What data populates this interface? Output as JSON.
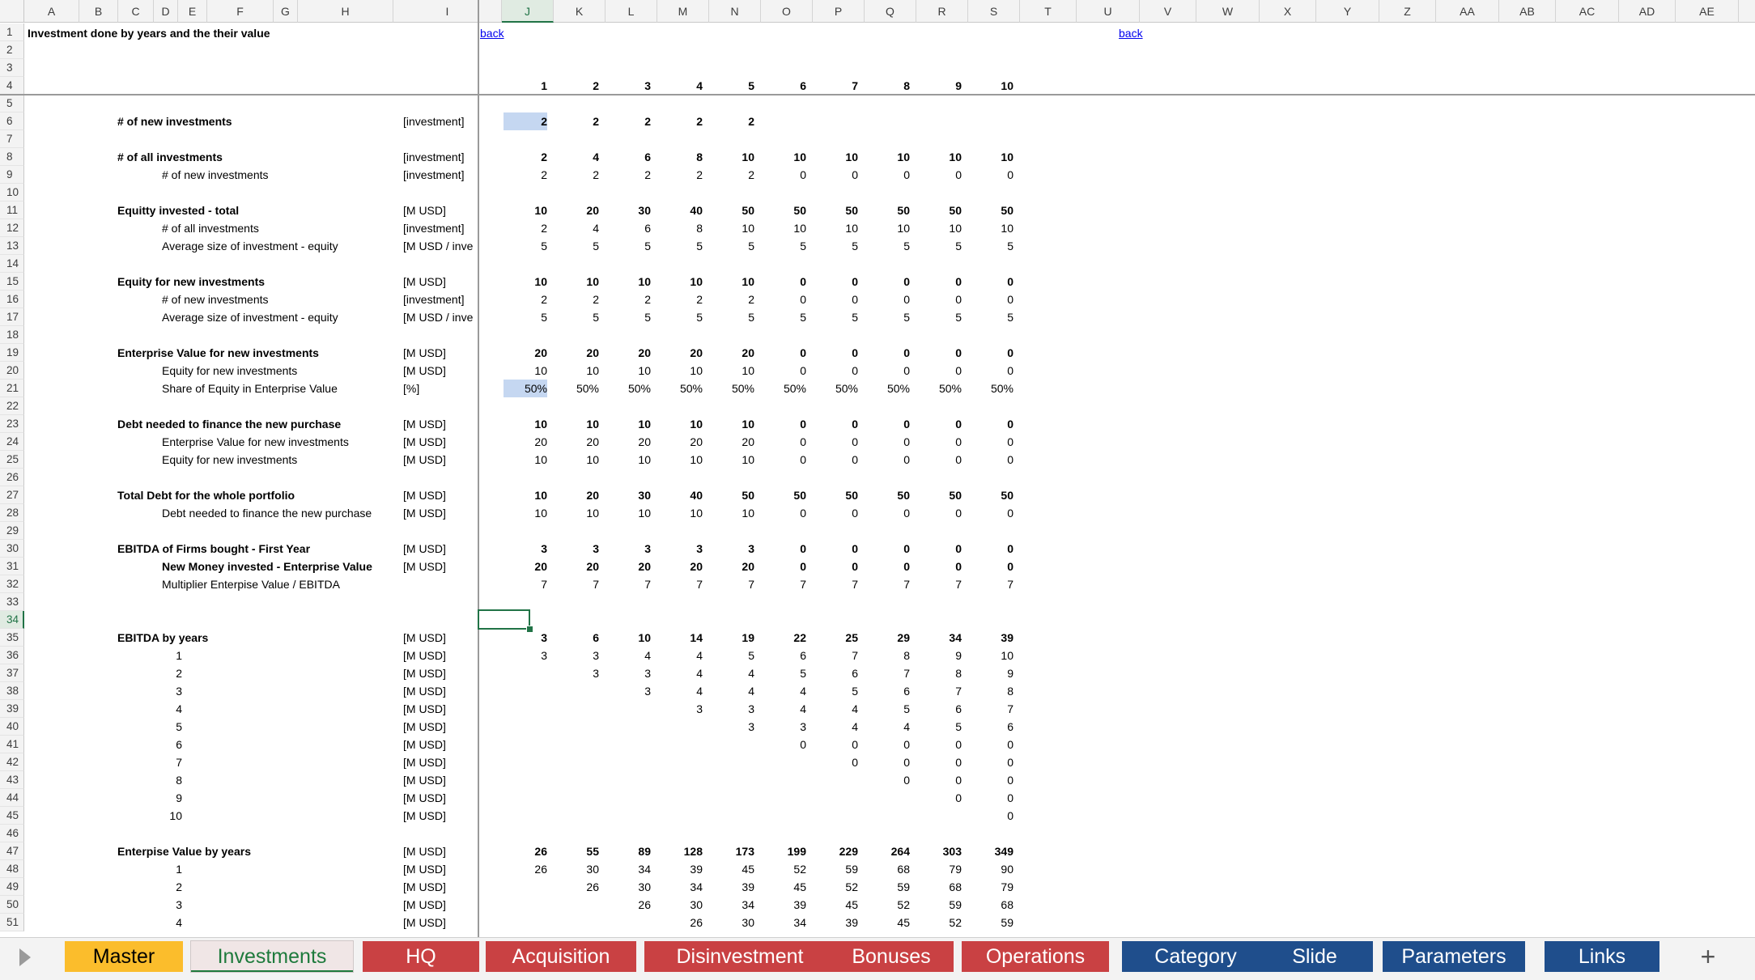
{
  "columns": [
    "A",
    "B",
    "C",
    "D",
    "E",
    "F",
    "G",
    "H",
    "I",
    "J",
    "K",
    "L",
    "M",
    "N",
    "O",
    "P",
    "Q",
    "R",
    "S",
    "T",
    "U",
    "V",
    "W",
    "X",
    "Y",
    "Z",
    "AA",
    "AB",
    "AC",
    "AD",
    "AE",
    "AF"
  ],
  "selected_column": "J",
  "selected_row": "34",
  "row_numbers": [
    "1",
    "2",
    "3",
    "4",
    "5",
    "6",
    "7",
    "8",
    "9",
    "10",
    "11",
    "12",
    "13",
    "14",
    "15",
    "16",
    "17",
    "18",
    "19",
    "20",
    "21",
    "22",
    "23",
    "24",
    "25",
    "26",
    "27",
    "28",
    "29",
    "30",
    "31",
    "32",
    "33",
    "34",
    "35",
    "36",
    "37",
    "38",
    "39",
    "40",
    "41",
    "42",
    "43",
    "44",
    "45",
    "46",
    "47",
    "48",
    "49",
    "50",
    "51"
  ],
  "title": "Investment done by years and the their value",
  "back_link_1": "back",
  "back_link_2": "back",
  "year_headers": [
    "1",
    "2",
    "3",
    "4",
    "5",
    "6",
    "7",
    "8",
    "9",
    "10"
  ],
  "rows": [
    {
      "row": "6",
      "label": "# of new investments",
      "indent": 1,
      "bold": true,
      "unit": "[investment]",
      "values": [
        "2",
        "2",
        "2",
        "2",
        "2",
        "",
        "",
        "",
        "",
        ""
      ]
    },
    {
      "row": "8",
      "label": "# of all investments",
      "indent": 1,
      "bold": true,
      "unit": "[investment]",
      "values": [
        "2",
        "4",
        "6",
        "8",
        "10",
        "10",
        "10",
        "10",
        "10",
        "10"
      ]
    },
    {
      "row": "9",
      "label": "# of new investments",
      "indent": 2,
      "bold": false,
      "unit": "[investment]",
      "values": [
        "2",
        "2",
        "2",
        "2",
        "2",
        "0",
        "0",
        "0",
        "0",
        "0"
      ]
    },
    {
      "row": "11",
      "label": "Equitty invested - total",
      "indent": 1,
      "bold": true,
      "unit": "[M USD]",
      "values": [
        "10",
        "20",
        "30",
        "40",
        "50",
        "50",
        "50",
        "50",
        "50",
        "50"
      ]
    },
    {
      "row": "12",
      "label": "# of all investments",
      "indent": 2,
      "bold": false,
      "unit": "[investment]",
      "values": [
        "2",
        "4",
        "6",
        "8",
        "10",
        "10",
        "10",
        "10",
        "10",
        "10"
      ]
    },
    {
      "row": "13",
      "label": "Average size of investment - equity",
      "indent": 2,
      "bold": false,
      "unit": "[M USD / inve",
      "values": [
        "5",
        "5",
        "5",
        "5",
        "5",
        "5",
        "5",
        "5",
        "5",
        "5"
      ]
    },
    {
      "row": "15",
      "label": "Equity for new investments",
      "indent": 1,
      "bold": true,
      "unit": "[M USD]",
      "values": [
        "10",
        "10",
        "10",
        "10",
        "10",
        "0",
        "0",
        "0",
        "0",
        "0"
      ]
    },
    {
      "row": "16",
      "label": "# of new investments",
      "indent": 2,
      "bold": false,
      "unit": "[investment]",
      "values": [
        "2",
        "2",
        "2",
        "2",
        "2",
        "0",
        "0",
        "0",
        "0",
        "0"
      ]
    },
    {
      "row": "17",
      "label": "Average size of investment - equity",
      "indent": 2,
      "bold": false,
      "unit": "[M USD / inve",
      "values": [
        "5",
        "5",
        "5",
        "5",
        "5",
        "5",
        "5",
        "5",
        "5",
        "5"
      ]
    },
    {
      "row": "19",
      "label": "Enterprise Value for new investments",
      "indent": 1,
      "bold": true,
      "unit": "[M USD]",
      "values": [
        "20",
        "20",
        "20",
        "20",
        "20",
        "0",
        "0",
        "0",
        "0",
        "0"
      ]
    },
    {
      "row": "20",
      "label": "Equity for new investments",
      "indent": 2,
      "bold": false,
      "unit": "[M USD]",
      "values": [
        "10",
        "10",
        "10",
        "10",
        "10",
        "0",
        "0",
        "0",
        "0",
        "0"
      ]
    },
    {
      "row": "21",
      "label": "Share of Equity in Enterprise Value",
      "indent": 2,
      "bold": false,
      "unit": "[%]",
      "values": [
        "50%",
        "50%",
        "50%",
        "50%",
        "50%",
        "50%",
        "50%",
        "50%",
        "50%",
        "50%"
      ]
    },
    {
      "row": "23",
      "label": "Debt needed to finance the new purchase",
      "indent": 1,
      "bold": true,
      "unit": "[M USD]",
      "values": [
        "10",
        "10",
        "10",
        "10",
        "10",
        "0",
        "0",
        "0",
        "0",
        "0"
      ]
    },
    {
      "row": "24",
      "label": "Enterprise Value for new investments",
      "indent": 2,
      "bold": false,
      "unit": "[M USD]",
      "values": [
        "20",
        "20",
        "20",
        "20",
        "20",
        "0",
        "0",
        "0",
        "0",
        "0"
      ]
    },
    {
      "row": "25",
      "label": "Equity for new investments",
      "indent": 2,
      "bold": false,
      "unit": "[M USD]",
      "values": [
        "10",
        "10",
        "10",
        "10",
        "10",
        "0",
        "0",
        "0",
        "0",
        "0"
      ]
    },
    {
      "row": "27",
      "label": "Total Debt for the whole portfolio",
      "indent": 1,
      "bold": true,
      "unit": "[M USD]",
      "values": [
        "10",
        "20",
        "30",
        "40",
        "50",
        "50",
        "50",
        "50",
        "50",
        "50"
      ]
    },
    {
      "row": "28",
      "label": "Debt needed to finance the new purchase",
      "indent": 2,
      "bold": false,
      "unit": "[M USD]",
      "values": [
        "10",
        "10",
        "10",
        "10",
        "10",
        "0",
        "0",
        "0",
        "0",
        "0"
      ]
    },
    {
      "row": "30",
      "label": "EBITDA of Firms bought - First Year",
      "indent": 1,
      "bold": true,
      "unit": "[M USD]",
      "values": [
        "3",
        "3",
        "3",
        "3",
        "3",
        "0",
        "0",
        "0",
        "0",
        "0"
      ]
    },
    {
      "row": "31",
      "label": "New Money invested - Enterprise Value",
      "indent": 2,
      "bold": true,
      "unit": "[M USD]",
      "values": [
        "20",
        "20",
        "20",
        "20",
        "20",
        "0",
        "0",
        "0",
        "0",
        "0"
      ]
    },
    {
      "row": "32",
      "label": "Multiplier Enterpise Value / EBITDA",
      "indent": 2,
      "bold": false,
      "unit": "",
      "values": [
        "7",
        "7",
        "7",
        "7",
        "7",
        "7",
        "7",
        "7",
        "7",
        "7"
      ]
    },
    {
      "row": "35",
      "label": "EBITDA by years",
      "indent": 1,
      "bold": true,
      "unit": "[M USD]",
      "values": [
        "3",
        "6",
        "10",
        "14",
        "19",
        "22",
        "25",
        "29",
        "34",
        "39"
      ]
    },
    {
      "row": "36",
      "label": "1",
      "indent": 3,
      "bold": false,
      "unit": "[M USD]",
      "values": [
        "3",
        "3",
        "4",
        "4",
        "5",
        "6",
        "7",
        "8",
        "9",
        "10"
      ]
    },
    {
      "row": "37",
      "label": "2",
      "indent": 3,
      "bold": false,
      "unit": "[M USD]",
      "values": [
        "",
        "3",
        "3",
        "4",
        "4",
        "5",
        "6",
        "7",
        "8",
        "9"
      ]
    },
    {
      "row": "38",
      "label": "3",
      "indent": 3,
      "bold": false,
      "unit": "[M USD]",
      "values": [
        "",
        "",
        "3",
        "4",
        "4",
        "4",
        "5",
        "6",
        "7",
        "8"
      ]
    },
    {
      "row": "39",
      "label": "4",
      "indent": 3,
      "bold": false,
      "unit": "[M USD]",
      "values": [
        "",
        "",
        "",
        "3",
        "3",
        "4",
        "4",
        "5",
        "6",
        "7"
      ]
    },
    {
      "row": "40",
      "label": "5",
      "indent": 3,
      "bold": false,
      "unit": "[M USD]",
      "values": [
        "",
        "",
        "",
        "",
        "3",
        "3",
        "4",
        "4",
        "5",
        "6"
      ]
    },
    {
      "row": "41",
      "label": "6",
      "indent": 3,
      "bold": false,
      "unit": "[M USD]",
      "values": [
        "",
        "",
        "",
        "",
        "",
        "0",
        "0",
        "0",
        "0",
        "0"
      ]
    },
    {
      "row": "42",
      "label": "7",
      "indent": 3,
      "bold": false,
      "unit": "[M USD]",
      "values": [
        "",
        "",
        "",
        "",
        "",
        "",
        "0",
        "0",
        "0",
        "0"
      ]
    },
    {
      "row": "43",
      "label": "8",
      "indent": 3,
      "bold": false,
      "unit": "[M USD]",
      "values": [
        "",
        "",
        "",
        "",
        "",
        "",
        "",
        "0",
        "0",
        "0"
      ]
    },
    {
      "row": "44",
      "label": "9",
      "indent": 3,
      "bold": false,
      "unit": "[M USD]",
      "values": [
        "",
        "",
        "",
        "",
        "",
        "",
        "",
        "",
        "0",
        "0"
      ]
    },
    {
      "row": "45",
      "label": "10",
      "indent": 3,
      "bold": false,
      "unit": "[M USD]",
      "values": [
        "",
        "",
        "",
        "",
        "",
        "",
        "",
        "",
        "",
        "0"
      ]
    },
    {
      "row": "47",
      "label": "Enterpise Value by years",
      "indent": 1,
      "bold": true,
      "unit": "[M USD]",
      "values": [
        "26",
        "55",
        "89",
        "128",
        "173",
        "199",
        "229",
        "264",
        "303",
        "349"
      ]
    },
    {
      "row": "48",
      "label": "1",
      "indent": 3,
      "bold": false,
      "unit": "[M USD]",
      "values": [
        "26",
        "30",
        "34",
        "39",
        "45",
        "52",
        "59",
        "68",
        "79",
        "90"
      ]
    },
    {
      "row": "49",
      "label": "2",
      "indent": 3,
      "bold": false,
      "unit": "[M USD]",
      "values": [
        "",
        "26",
        "30",
        "34",
        "39",
        "45",
        "52",
        "59",
        "68",
        "79"
      ]
    },
    {
      "row": "50",
      "label": "3",
      "indent": 3,
      "bold": false,
      "unit": "[M USD]",
      "values": [
        "",
        "",
        "26",
        "30",
        "34",
        "39",
        "45",
        "52",
        "59",
        "68"
      ]
    },
    {
      "row": "51",
      "label": "4",
      "indent": 3,
      "bold": false,
      "unit": "[M USD]",
      "values": [
        "",
        "",
        "",
        "26",
        "30",
        "34",
        "39",
        "45",
        "52",
        "59"
      ]
    }
  ],
  "highlighted_cells": [
    "J6",
    "J21"
  ],
  "tabs": [
    {
      "label": "Master",
      "bg": "#fbbd2c",
      "fg": "#000000",
      "active": false
    },
    {
      "label": "Investments",
      "bg": "#f0e6e6",
      "fg": "#1e7a3c",
      "active": true
    },
    {
      "label": "HQ",
      "bg": "#c94143",
      "fg": "#ffffff",
      "active": false
    },
    {
      "label": "Acquisition",
      "bg": "#c94143",
      "fg": "#ffffff",
      "active": false
    },
    {
      "label": "Disinvestment",
      "bg": "#c94143",
      "fg": "#ffffff",
      "active": false
    },
    {
      "label": "Bonuses",
      "bg": "#c94143",
      "fg": "#ffffff",
      "active": false
    },
    {
      "label": "Operations",
      "bg": "#c94143",
      "fg": "#ffffff",
      "active": false
    },
    {
      "label": "Category",
      "bg": "#1f4e8c",
      "fg": "#ffffff",
      "active": false
    },
    {
      "label": "Slide",
      "bg": "#1f4e8c",
      "fg": "#ffffff",
      "active": false
    },
    {
      "label": "Parameters",
      "bg": "#1f4e8c",
      "fg": "#ffffff",
      "active": false
    },
    {
      "label": "Links",
      "bg": "#1f4e8c",
      "fg": "#ffffff",
      "active": false
    }
  ],
  "add_tab_label": "+"
}
